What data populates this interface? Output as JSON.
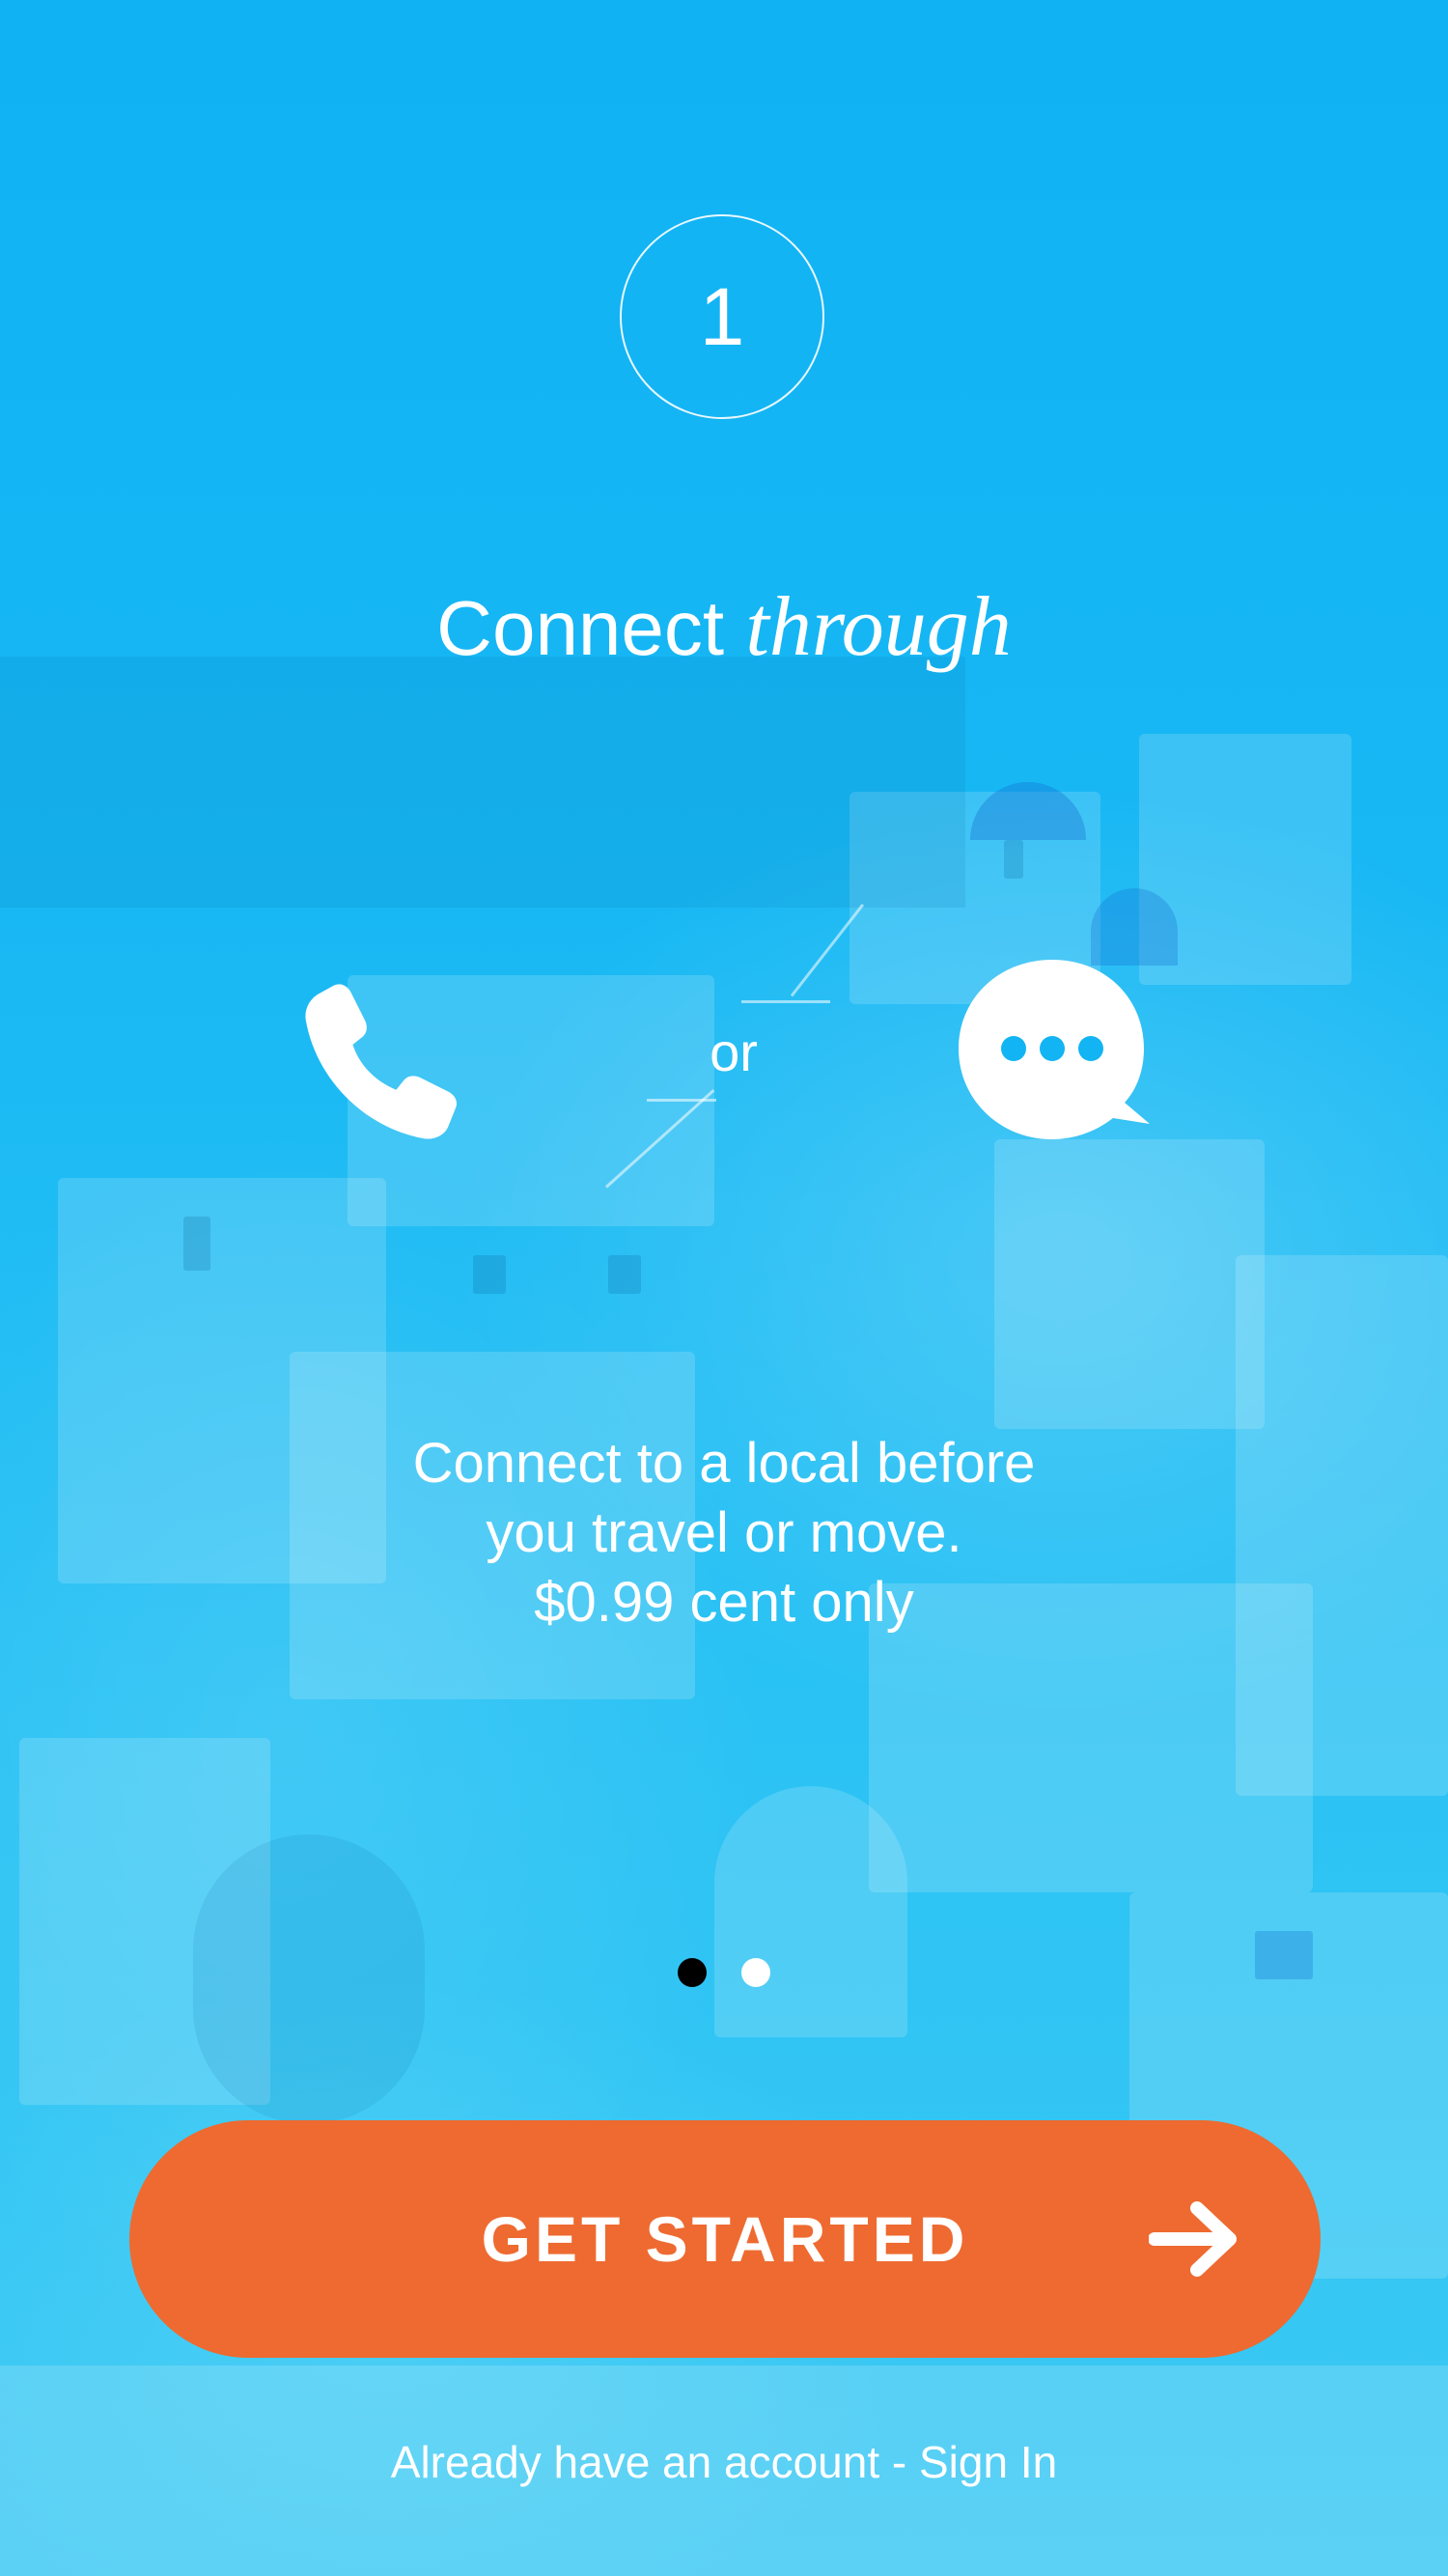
{
  "onboarding": {
    "step_number": "1",
    "heading_regular": "Connect",
    "heading_script": "through",
    "separator_label": "or",
    "description_lines": [
      "Connect to a local before",
      "you travel or move.",
      "$0.99 cent only"
    ],
    "pagination": {
      "total": 2,
      "active_index": 0
    }
  },
  "cta": {
    "label": "GET STARTED",
    "icon": "arrow-right-icon"
  },
  "footer": {
    "signin_text": "Already have an account - Sign In"
  },
  "icons": {
    "call": "phone-icon",
    "message": "chat-bubble-icon"
  },
  "colors": {
    "background": "#13b4f3",
    "accent": "#ee6a30",
    "text": "#ffffff",
    "active_dot": "#000000",
    "inactive_dot": "#ffffff"
  }
}
